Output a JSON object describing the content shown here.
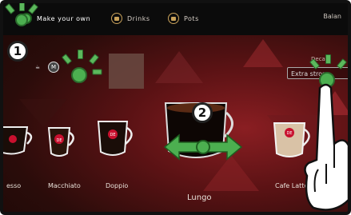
{
  "topbar": {
    "tabs": [
      {
        "label": "Make your own",
        "active": true
      },
      {
        "label": "Drinks",
        "active": false
      },
      {
        "label": "Pots",
        "active": false
      }
    ],
    "balance_label": "Balan"
  },
  "options": {
    "size_letter": "M",
    "decaf_label": "Decaf",
    "strength_label": "Extra strong"
  },
  "drinks": [
    {
      "label": "esso"
    },
    {
      "label": "Macchiato"
    },
    {
      "label": "Doppio"
    },
    {
      "label": "Lungo"
    },
    {
      "label": "Cafe Latte"
    }
  ],
  "cup_logo": "DE",
  "steps": [
    "1",
    "2"
  ],
  "colors": {
    "accent_green": "#4caf50",
    "brand_red": "#c8102e",
    "tab_gold": "#c9a25a"
  }
}
